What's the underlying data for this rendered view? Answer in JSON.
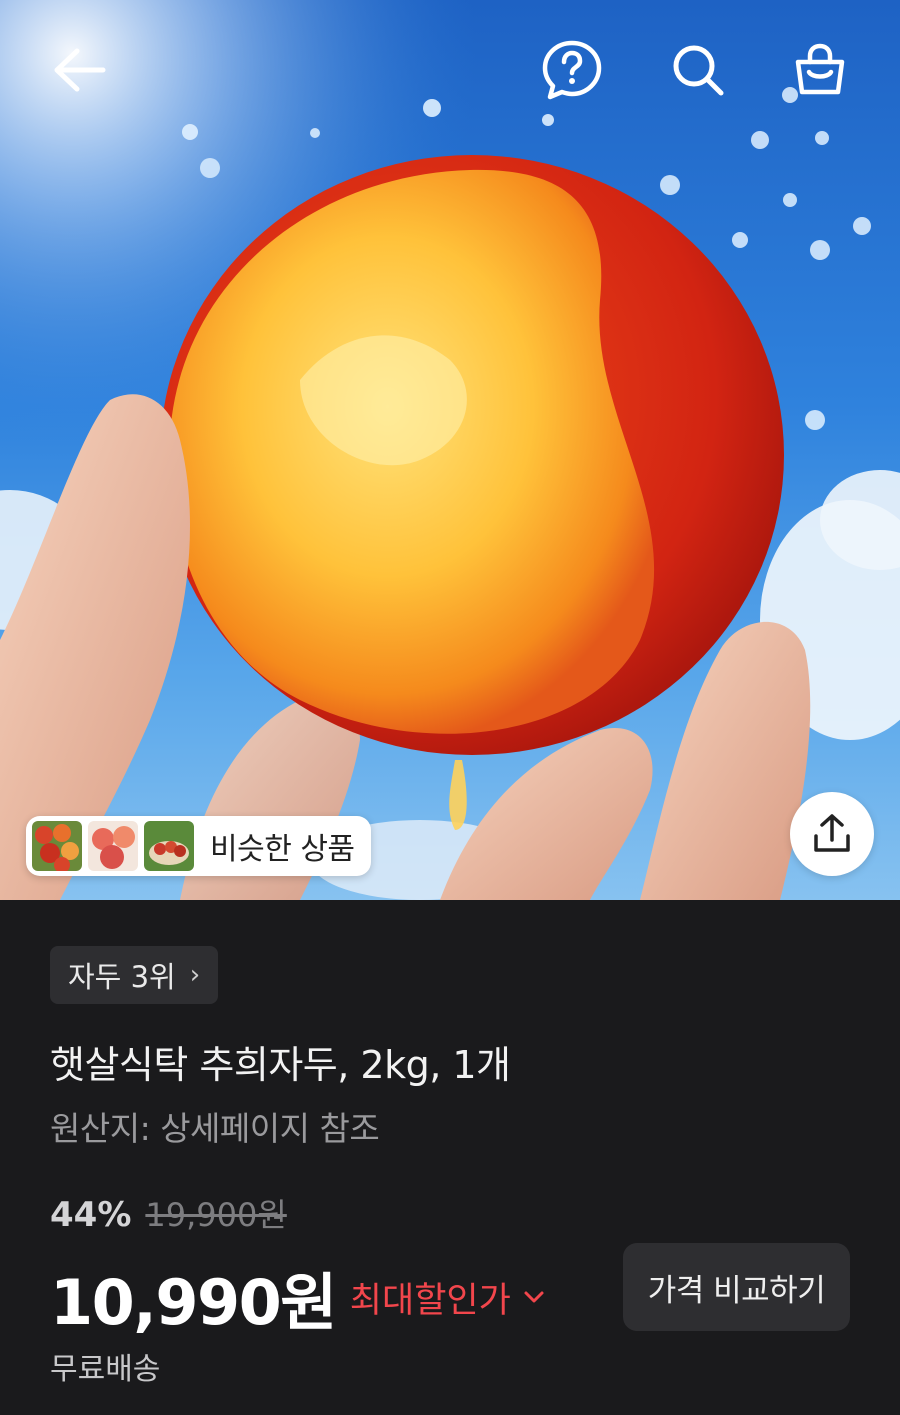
{
  "hero": {
    "icons": [
      "back-arrow-icon",
      "help-icon",
      "search-icon",
      "cart-icon",
      "share-icon"
    ],
    "similar_products_label": "비슷한 상품"
  },
  "product": {
    "rank_label": "자두 3위",
    "title": "햇살식탁 추희자두, 2kg, 1개",
    "origin": "원산지: 상세페이지 참조",
    "discount_rate": "44%",
    "original_price": "19,900원",
    "price": "10,990원",
    "max_discount_label": "최대할인가",
    "compare_button_label": "가격 비교하기",
    "shipping": "무료배송"
  },
  "colors": {
    "background": "#1a1a1c",
    "chip": "#2e2e31",
    "accent_red": "#f2464c",
    "sky": "#2f82dd"
  }
}
